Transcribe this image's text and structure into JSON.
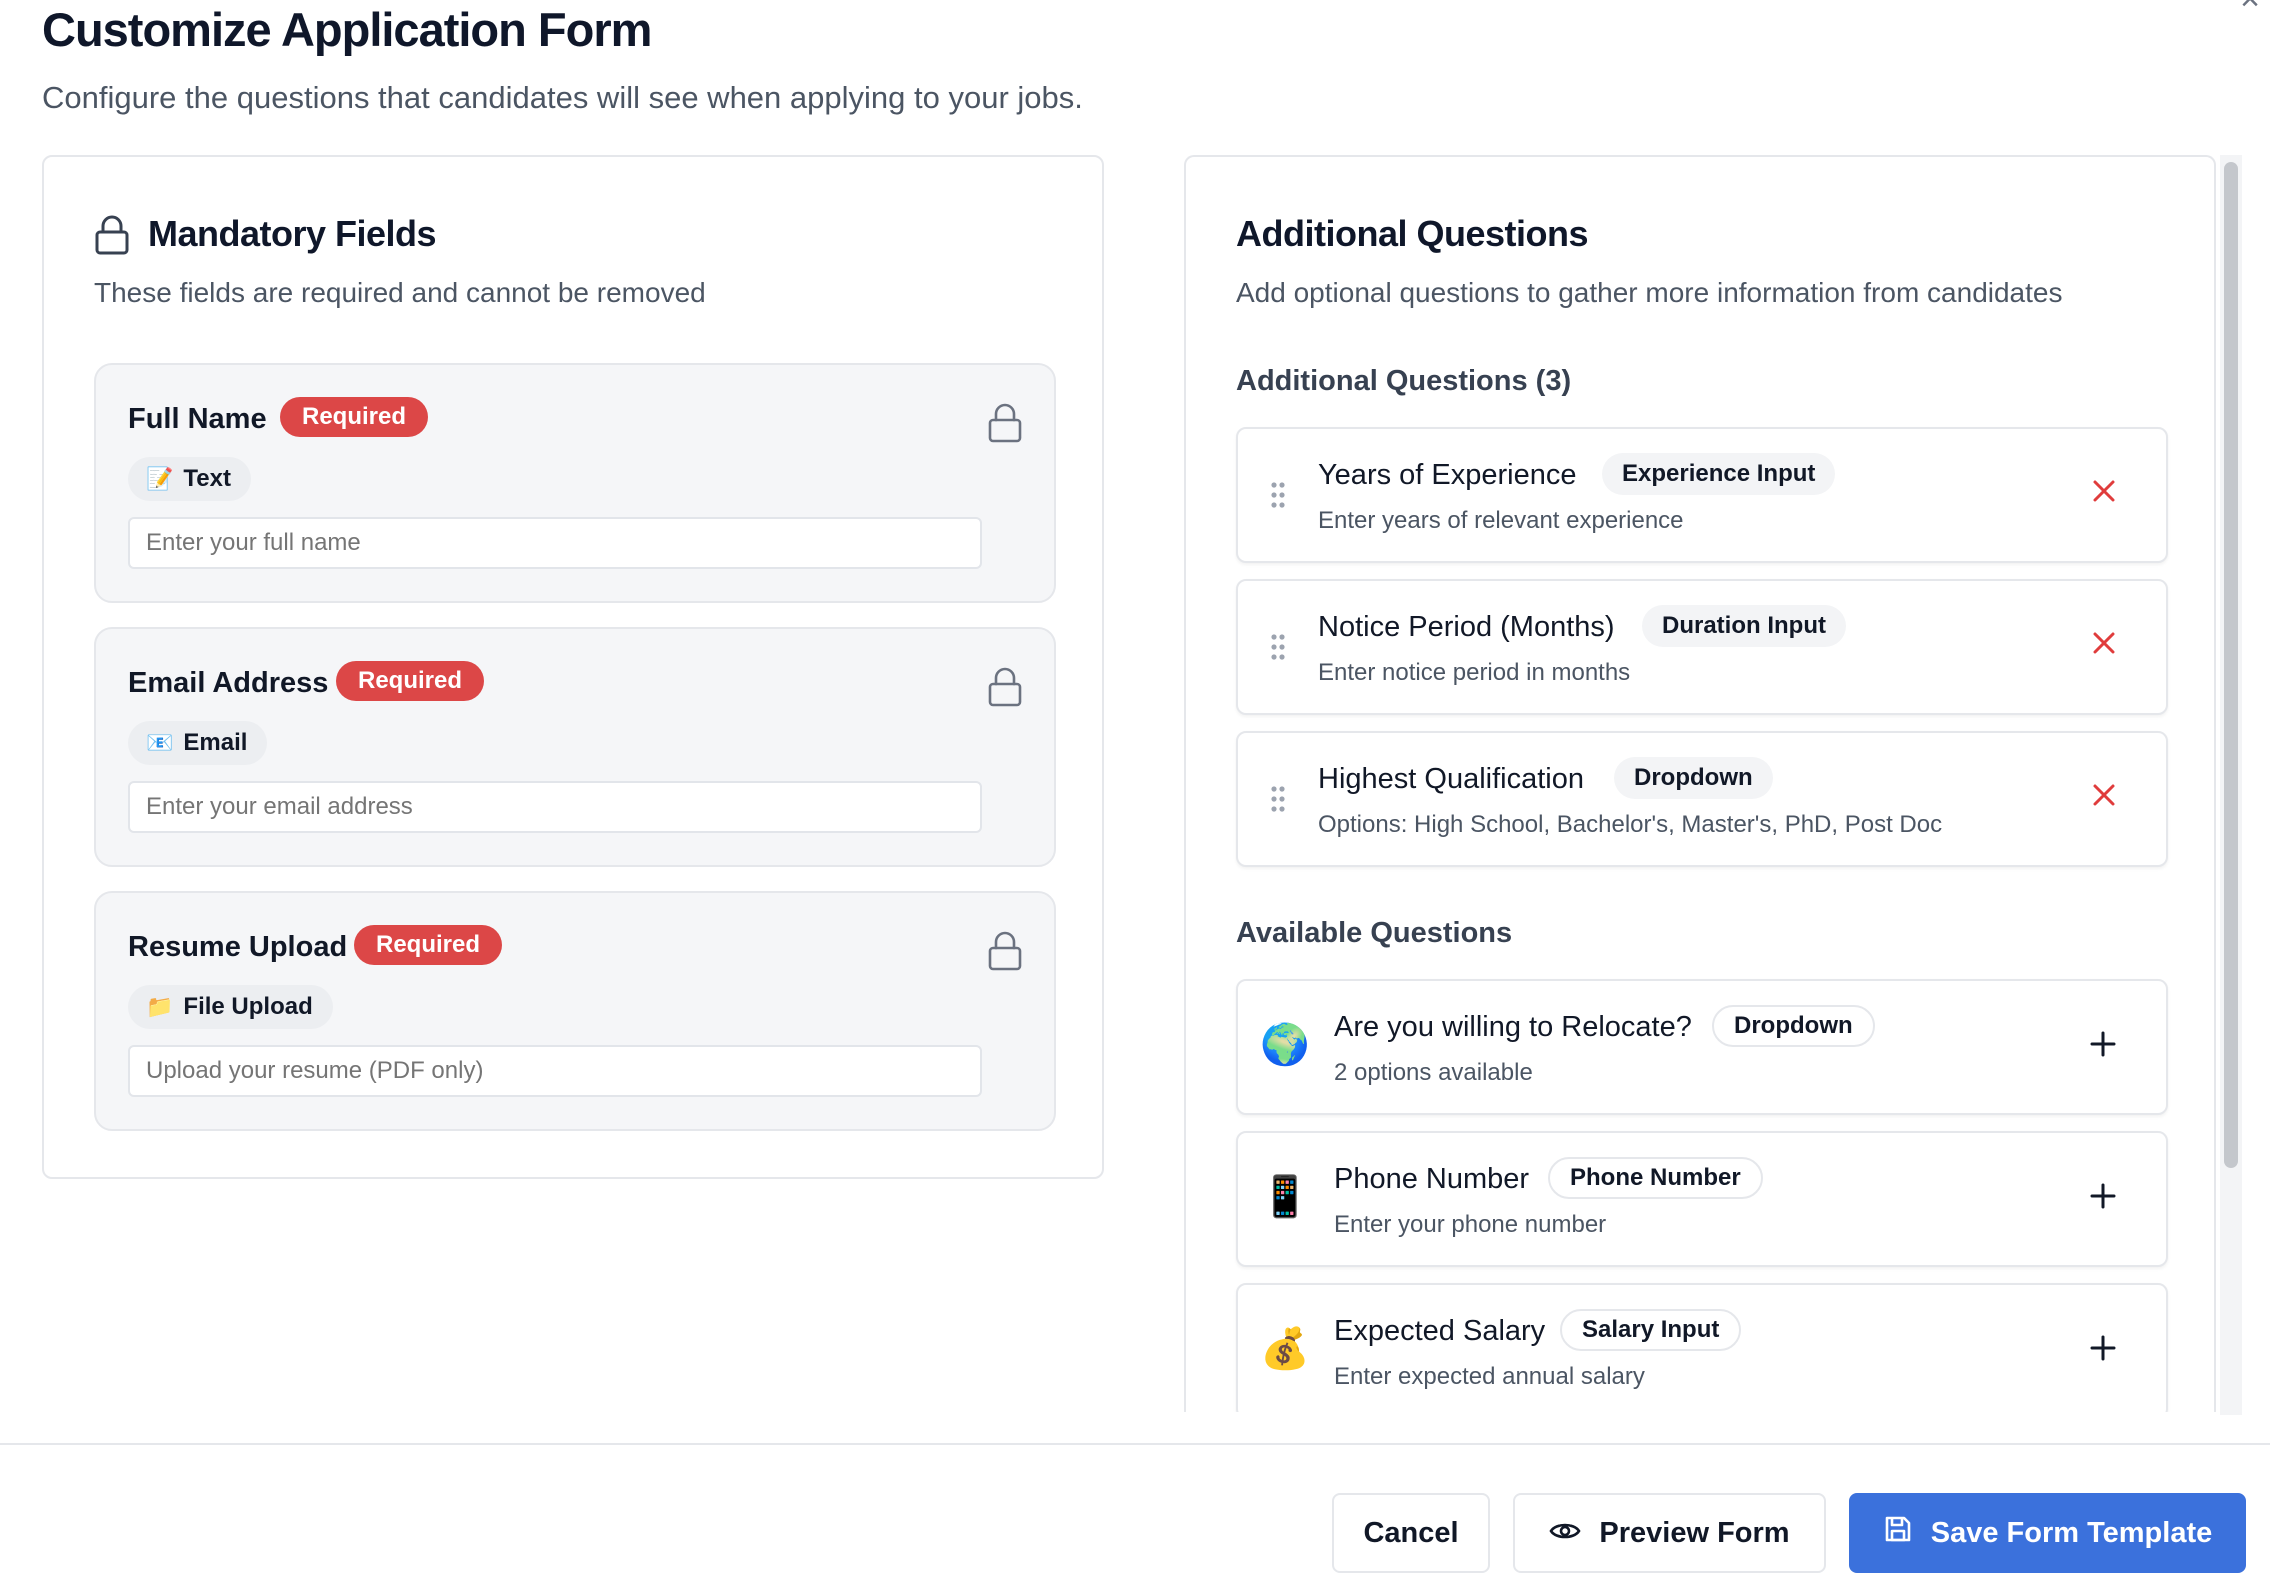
{
  "header": {
    "title": "Customize Application Form",
    "subtitle": "Configure the questions that candidates will see when applying to your jobs.",
    "close_icon": "close-icon"
  },
  "mandatory": {
    "title": "Mandatory Fields",
    "description": "These fields are required and cannot be removed",
    "required_label": "Required",
    "fields": [
      {
        "label": "Full Name",
        "type_emoji": "📝",
        "type_label": "Text",
        "placeholder": "Enter your full name"
      },
      {
        "label": "Email Address",
        "type_emoji": "📧",
        "type_label": "Email",
        "placeholder": "Enter your email address"
      },
      {
        "label": "Resume Upload",
        "type_emoji": "📁",
        "type_label": "File Upload",
        "placeholder": "Upload your resume (PDF only)"
      }
    ]
  },
  "additional": {
    "title": "Additional Questions",
    "description": "Add optional questions to gather more information from candidates",
    "added_heading": "Additional Questions (3)",
    "added": [
      {
        "title": "Years of Experience",
        "type": "Experience Input",
        "desc": "Enter years of relevant experience"
      },
      {
        "title": "Notice Period (Months)",
        "type": "Duration Input",
        "desc": "Enter notice period in months"
      },
      {
        "title": "Highest Qualification",
        "type": "Dropdown",
        "desc": "Options: High School, Bachelor's, Master's, PhD, Post Doc"
      }
    ],
    "available_heading": "Available Questions",
    "available": [
      {
        "emoji": "🌍",
        "title": "Are you willing to Relocate?",
        "type": "Dropdown",
        "desc": "2 options available"
      },
      {
        "emoji": "📱",
        "title": "Phone Number",
        "type": "Phone Number",
        "desc": "Enter your phone number"
      },
      {
        "emoji": "💰",
        "title": "Expected Salary",
        "type": "Salary Input",
        "desc": "Enter expected annual salary"
      }
    ]
  },
  "footer": {
    "cancel_label": "Cancel",
    "preview_label": "Preview Form",
    "save_label": "Save Form Template"
  },
  "colors": {
    "required_badge": "#dc4747",
    "primary_button": "#3b71dc",
    "remove_icon": "#e03c3c"
  }
}
